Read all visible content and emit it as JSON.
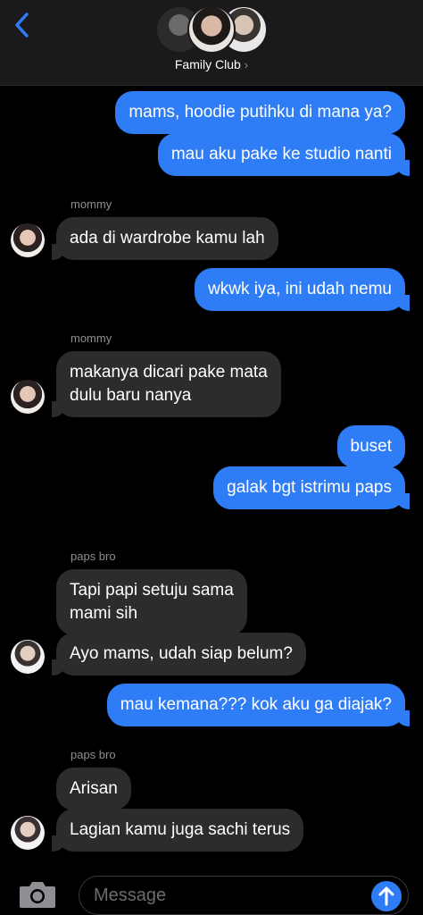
{
  "header": {
    "group_name": "Family Club",
    "chevron": "›",
    "back_icon": "chevron-left-icon"
  },
  "messages": [
    {
      "dir": "out",
      "text": "mams, hoodie putihku di mana ya?"
    },
    {
      "dir": "out",
      "text": "mau aku pake ke studio nanti"
    },
    {
      "dir": "in",
      "sender": "mommy",
      "text": "ada di wardrobe kamu lah"
    },
    {
      "dir": "out",
      "text": "wkwk iya, ini udah nemu"
    },
    {
      "dir": "in",
      "sender": "mommy",
      "line1": "makanya dicari pake mata",
      "line2": "dulu baru nanya"
    },
    {
      "dir": "out",
      "text": "buset"
    },
    {
      "dir": "out",
      "text": "galak bgt istrimu paps"
    },
    {
      "dir": "in",
      "sender": "paps bro",
      "line1": "Tapi papi setuju sama",
      "line2": "mami sih"
    },
    {
      "dir": "in",
      "text": "Ayo mams, udah siap belum?"
    },
    {
      "dir": "out",
      "text": "mau kemana??? kok aku ga diajak?"
    },
    {
      "dir": "in",
      "sender": "paps bro",
      "text": "Arisan"
    },
    {
      "dir": "in",
      "text": "Lagian kamu juga sachi terus"
    }
  ],
  "input": {
    "placeholder": "Message",
    "camera_icon": "camera-icon",
    "send_icon": "arrow-up-icon"
  },
  "colors": {
    "outgoing_bubble": "#2f7df6",
    "incoming_bubble": "#2c2c2e",
    "background": "#000000",
    "header": "#1a1a1c"
  }
}
